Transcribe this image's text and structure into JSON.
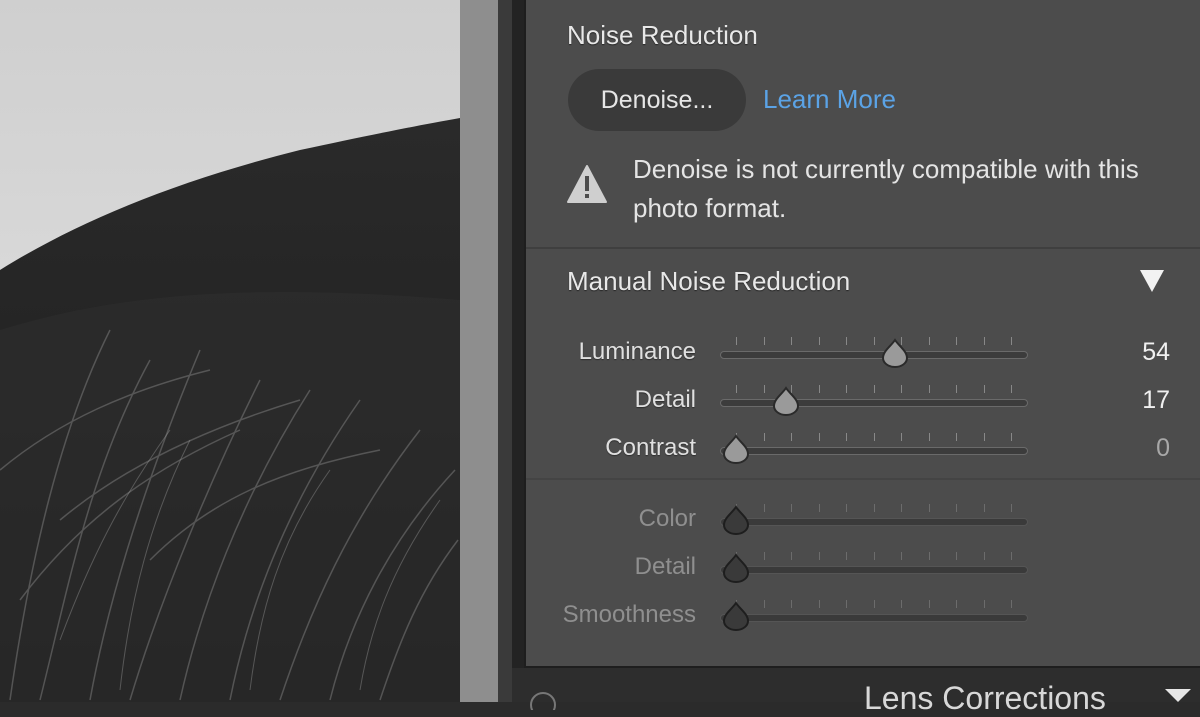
{
  "noise_reduction": {
    "title": "Noise Reduction",
    "denoise_button": "Denoise...",
    "learn_more": "Learn More",
    "warning": "Denoise is not currently compatible with this photo format."
  },
  "manual": {
    "title": "Manual Noise Reduction",
    "luminance_sliders": [
      {
        "label": "Luminance",
        "value": "54",
        "fraction": 0.54
      },
      {
        "label": "Detail",
        "value": "17",
        "fraction": 0.17
      },
      {
        "label": "Contrast",
        "value": "0",
        "fraction": 0.0
      }
    ],
    "color_sliders": [
      {
        "label": "Color",
        "value": "",
        "fraction": 0.0
      },
      {
        "label": "Detail",
        "value": "",
        "fraction": 0.0
      },
      {
        "label": "Smoothness",
        "value": "",
        "fraction": 0.0
      }
    ]
  },
  "next_panel": {
    "title": "Lens Corrections"
  },
  "colors": {
    "panel_bg": "#4c4c4c",
    "link": "#5ba3e6",
    "text": "#e2e2e2",
    "dim_text": "#8f8f8f"
  },
  "icons": {
    "warning": "warning-triangle-icon",
    "disclosure": "triangle-down-icon",
    "next_chevron": "triangle-down-icon",
    "help": "help-circle-icon"
  }
}
